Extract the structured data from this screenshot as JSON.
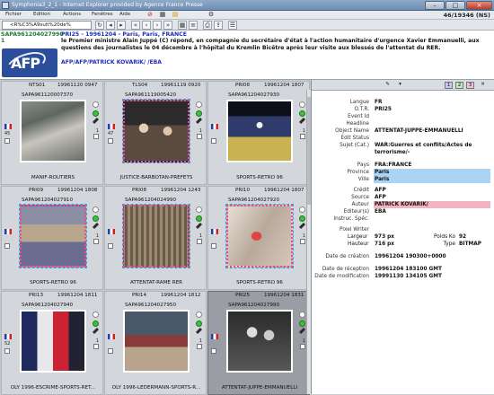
{
  "window": {
    "title": "Symphonia3_2_1 - Internet Explorer provided by Agence France Presse"
  },
  "menu": [
    "Fichier",
    "Edition",
    "Actions",
    "Fenêtres",
    "Aide"
  ],
  "toolbar": {
    "query_value": "<R%C3%A9sult%20de%"
  },
  "counter": "46/19346 (NS)",
  "info": {
    "id": "SAPA961204027990",
    "headline": "PRI25 - 19961204 - Paris, Paris, FRANCE",
    "one": "1",
    "text": "le Premier ministre Alain Juppé (C) répond, en compagnie du secrétaire d'état à l'action humanitaire d'urgence Xavier Emmanuelli, aux questions des journalistes le 04 décembre à l'hôpital du Kremlin Bicêtre après leur visite aux blessés de l'attentat du RER.",
    "author": "AFP/AFP/PATRICK KOVARIK/ /EBA",
    "logo": "AFP"
  },
  "cells": [
    {
      "code": "NTS01",
      "date": "19961120 0947",
      "ref": "SAPA961120007370",
      "caption": "MANIF-ROUTIERS",
      "num": "45",
      "rnum": "1"
    },
    {
      "code": "TLS04",
      "date": "19961119 0920",
      "ref": "SAPA961119005420",
      "caption": "JUSTICE-BARBOTAN-PREFETS",
      "num": "47",
      "rnum": "1"
    },
    {
      "code": "PRI08",
      "date": "19961204 1807",
      "ref": "SAPA961204027930",
      "caption": "SPORTS-RETRO 96",
      "num": "",
      "rnum": "1"
    },
    {
      "code": "PRI09",
      "date": "19961204 1808",
      "ref": "SAPA961204027910",
      "caption": "SPORTS-RETRO 96",
      "num": "",
      "rnum": "1"
    },
    {
      "code": "PRI08",
      "date": "19961204 1243",
      "ref": "SAPA961204024990",
      "caption": "ATTENTAT-RAME RER",
      "num": "",
      "rnum": "1"
    },
    {
      "code": "PRI10",
      "date": "19961204 1807",
      "ref": "SAPA961204027920",
      "caption": "SPORTS-RETRO 96",
      "num": "",
      "rnum": "1"
    },
    {
      "code": "PRI13",
      "date": "19961204 1811",
      "ref": "SAPA961204027940",
      "caption": "OLY 1996-ESCRIME-SPORTS-RET...",
      "num": "52",
      "rnum": "1"
    },
    {
      "code": "PRI14",
      "date": "19961204 1812",
      "ref": "SAPA961204027950",
      "caption": "OLY 1996-LEDERMANN-SPORTS-R...",
      "num": "",
      "rnum": "1"
    },
    {
      "code": "PRI25",
      "date": "19961204 1831",
      "ref": "SAPA961204027990",
      "caption": "ATTENTAT-JUPPE-EMMANUELLI",
      "num": "",
      "rnum": "1"
    }
  ],
  "panel": {
    "tabs": [
      "1",
      "2",
      "3"
    ],
    "rows": [
      {
        "label": "Langue",
        "value": "FR"
      },
      {
        "label": "O.T.R.",
        "value": "PRI25"
      },
      {
        "label": "Event Id",
        "value": ""
      },
      {
        "label": "Headline",
        "value": ""
      },
      {
        "label": "Object Name",
        "value": "ATTENTAT-JUPPE-EMMANUELLI"
      },
      {
        "label": "Edit Status",
        "value": ""
      },
      {
        "label": "Sujet (Cat.)",
        "value": "WAR:Guerres et conflits/Actes de"
      },
      {
        "label": "",
        "value": "terrorisme/-"
      },
      {
        "label": "Pays",
        "value": "FRA:FRANCE"
      },
      {
        "label": "Province",
        "value": "Paris"
      },
      {
        "label": "Ville",
        "value": "Paris"
      },
      {
        "label": "Crédit",
        "value": "AFP"
      },
      {
        "label": "Source",
        "value": "AFP"
      },
      {
        "label": "Auteur",
        "value": "PATRICK KOVARIK/"
      },
      {
        "label": "Editeur(s)",
        "value": "EBA"
      },
      {
        "label": "Instruc. Spéc.",
        "value": ""
      },
      {
        "label": "Pixel Writer",
        "value": ""
      },
      {
        "label": "Date de création",
        "value": "19961204 190300+0000"
      },
      {
        "label": "Date de réception",
        "value": "19961204 183100 GMT"
      },
      {
        "label": "Date de modification",
        "value": "19991130 134105 GMT"
      }
    ],
    "largeur_label": "Largeur",
    "largeur": "973 px",
    "hauteur_label": "Hauteur",
    "hauteur": "716 px",
    "poids_label": "Poids Ko",
    "poids": "92",
    "type_label": "Type",
    "type": "BITMAP"
  }
}
